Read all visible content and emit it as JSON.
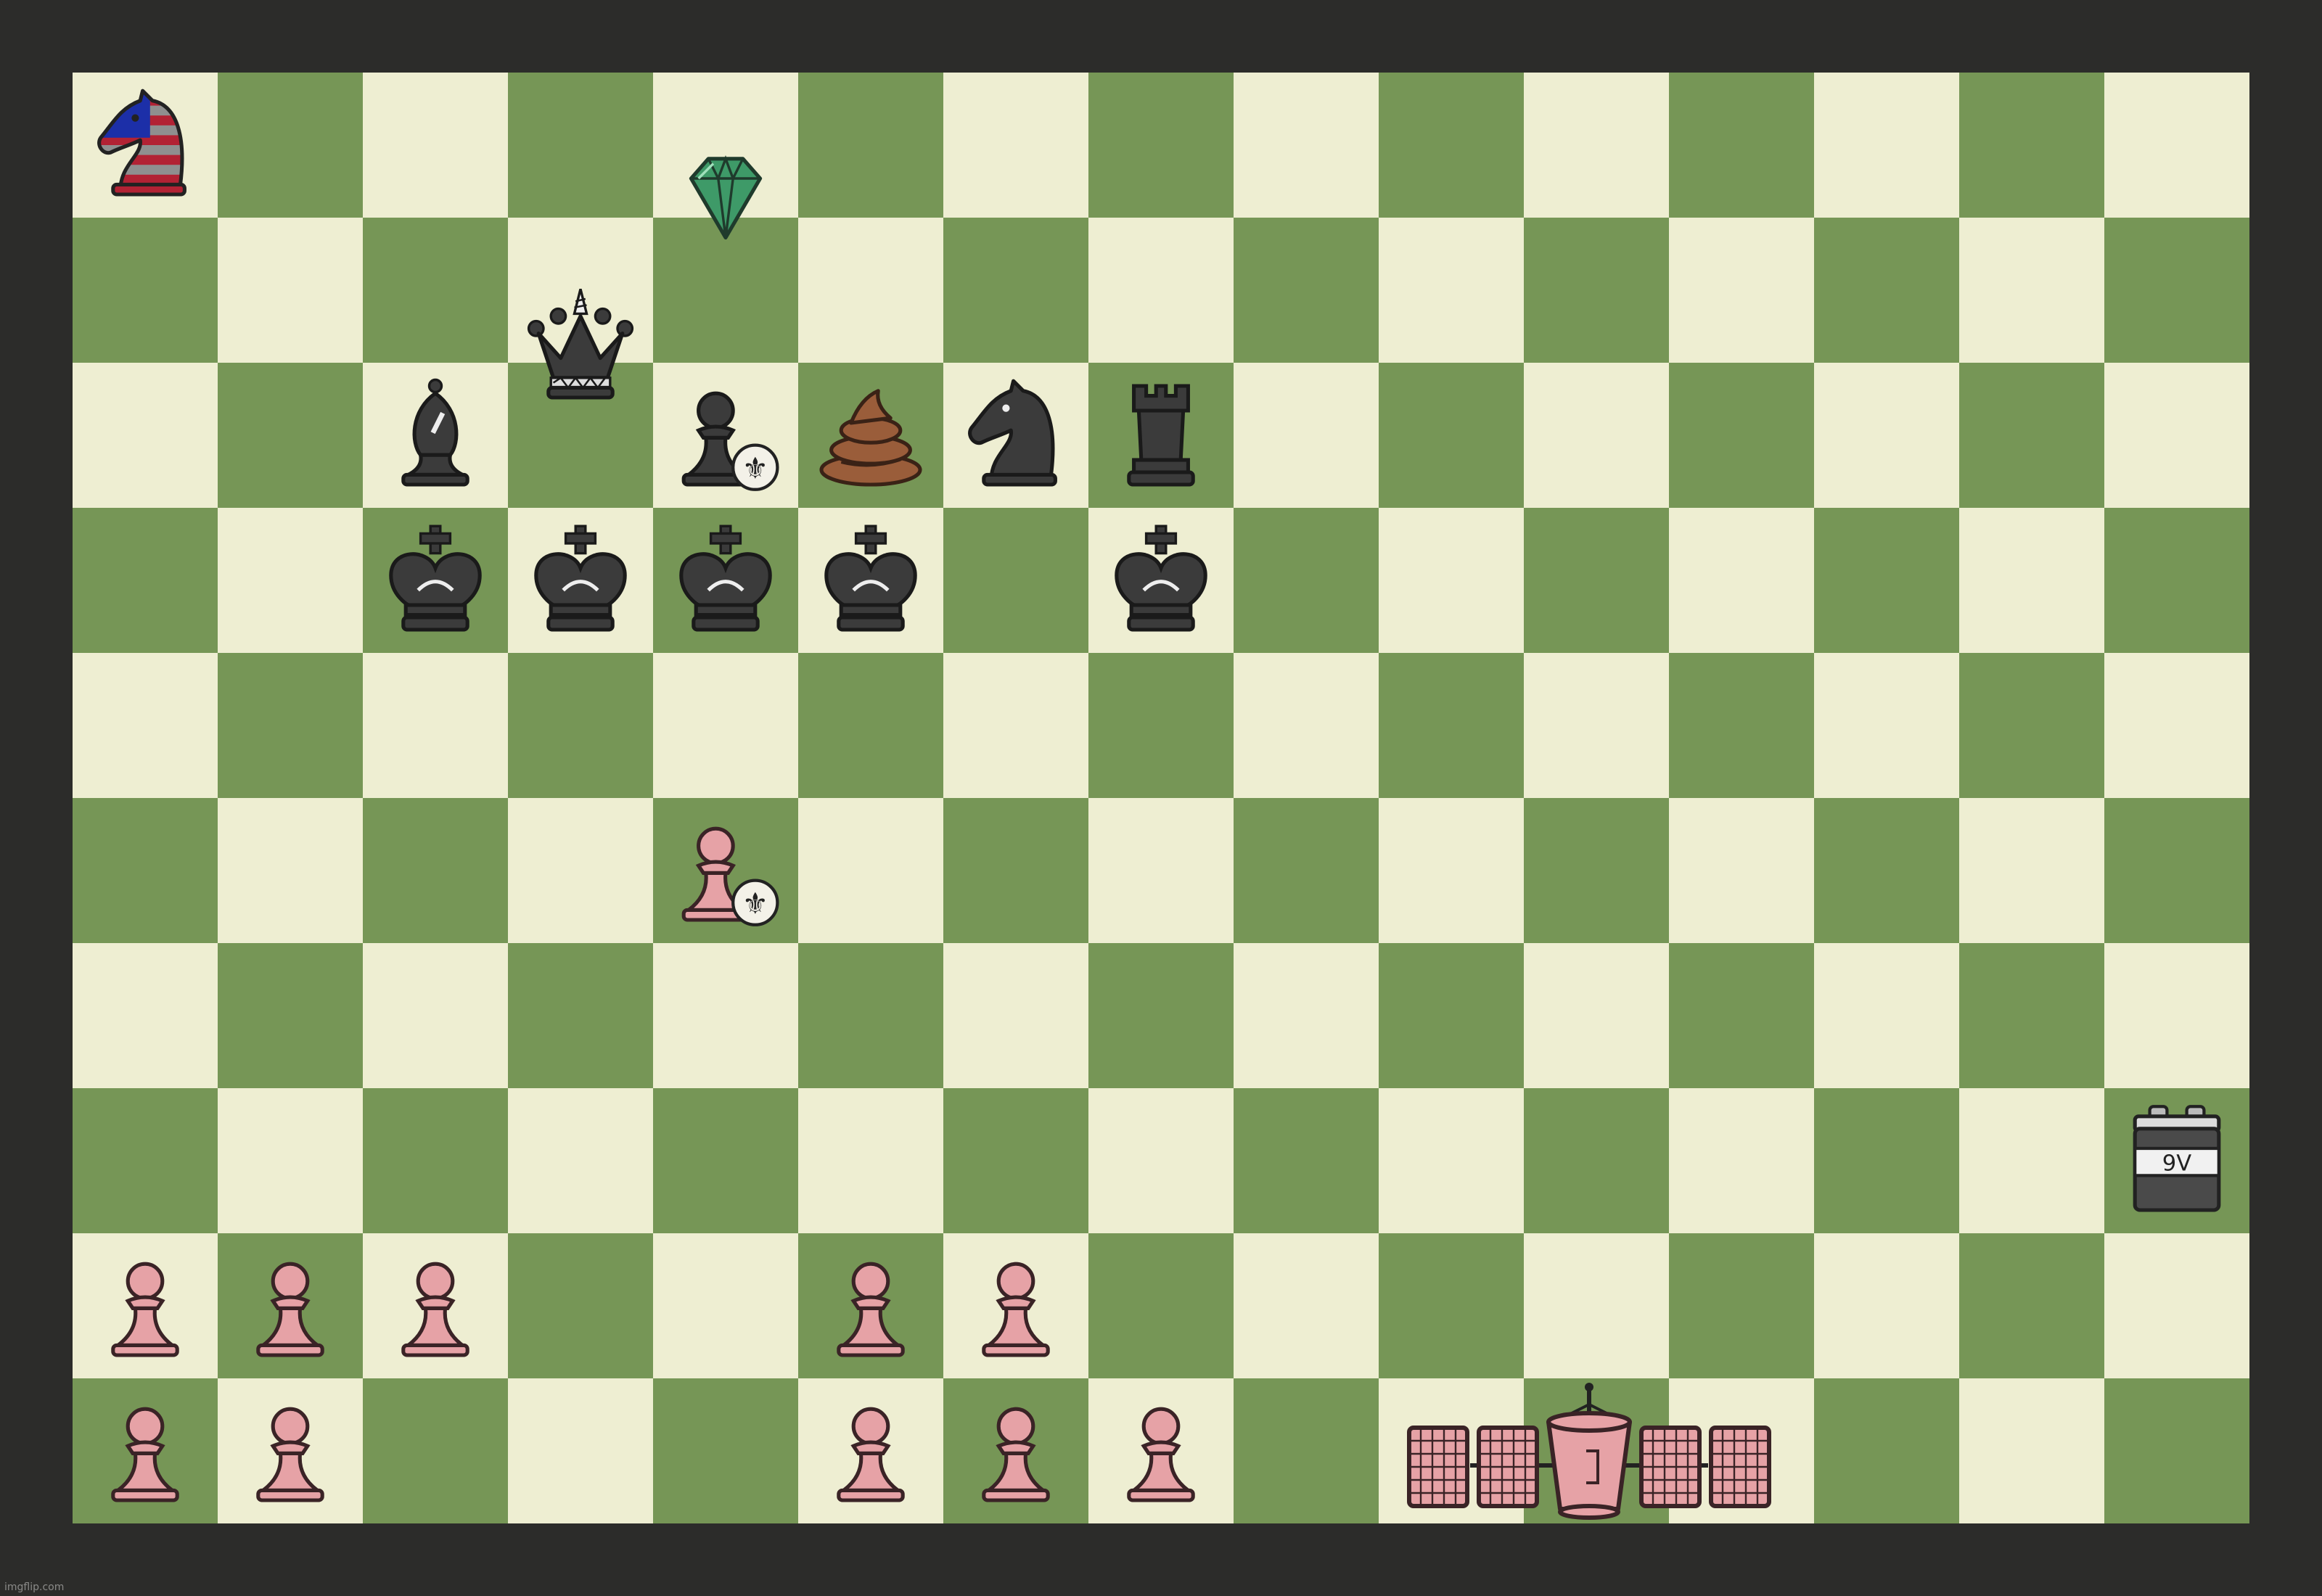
{
  "board": {
    "files": 15,
    "ranks": 10,
    "colors": {
      "light": "#eeeed2",
      "dark": "#769656",
      "frame": "#2c2c2a"
    }
  },
  "pieces": [
    {
      "name": "american-flag-knight-icon",
      "type": "flag-knight",
      "col": 0,
      "row": 0
    },
    {
      "name": "green-gem-icon",
      "type": "gem",
      "col": 4,
      "row": 0,
      "offset": "edge"
    },
    {
      "name": "black-queen-icon",
      "type": "queen",
      "col": 3,
      "row": 1,
      "offset": "edge"
    },
    {
      "name": "black-bishop-icon",
      "type": "bishop",
      "col": 2,
      "row": 2
    },
    {
      "name": "black-pawn-fleur-icon",
      "type": "pawn-fleur",
      "color": "black",
      "col": 4,
      "row": 2
    },
    {
      "name": "poop-icon",
      "type": "poop",
      "col": 5,
      "row": 2
    },
    {
      "name": "black-knight-icon",
      "type": "knight",
      "col": 6,
      "row": 2
    },
    {
      "name": "black-rook-icon",
      "type": "rook",
      "col": 7,
      "row": 2
    },
    {
      "name": "black-king-icon",
      "type": "king",
      "col": 2,
      "row": 3
    },
    {
      "name": "black-king-icon",
      "type": "king",
      "col": 3,
      "row": 3
    },
    {
      "name": "black-king-icon",
      "type": "king",
      "col": 4,
      "row": 3
    },
    {
      "name": "black-king-icon",
      "type": "king",
      "col": 5,
      "row": 3
    },
    {
      "name": "black-king-icon",
      "type": "king",
      "col": 7,
      "row": 3
    },
    {
      "name": "pink-pawn-fleur-icon",
      "type": "pawn-fleur",
      "color": "pink",
      "col": 4,
      "row": 5
    },
    {
      "name": "nine-volt-battery-icon",
      "type": "battery",
      "col": 14,
      "row": 7
    },
    {
      "name": "pink-pawn-icon",
      "type": "pawn",
      "col": 0,
      "row": 8
    },
    {
      "name": "pink-pawn-icon",
      "type": "pawn",
      "col": 1,
      "row": 8
    },
    {
      "name": "pink-pawn-icon",
      "type": "pawn",
      "col": 2,
      "row": 8
    },
    {
      "name": "pink-pawn-icon",
      "type": "pawn",
      "col": 5,
      "row": 8
    },
    {
      "name": "pink-pawn-icon",
      "type": "pawn",
      "col": 6,
      "row": 8
    },
    {
      "name": "pink-pawn-icon",
      "type": "pawn",
      "col": 0,
      "row": 9
    },
    {
      "name": "pink-pawn-icon",
      "type": "pawn",
      "col": 1,
      "row": 9
    },
    {
      "name": "pink-pawn-icon",
      "type": "pawn",
      "col": 5,
      "row": 9
    },
    {
      "name": "pink-pawn-icon",
      "type": "pawn",
      "col": 6,
      "row": 9
    },
    {
      "name": "pink-pawn-icon",
      "type": "pawn",
      "col": 7,
      "row": 9
    },
    {
      "name": "pink-satellite-icon",
      "type": "satellite",
      "col": 9,
      "row": 9
    }
  ],
  "battery_label": "9V",
  "watermark": "imgflip.com"
}
